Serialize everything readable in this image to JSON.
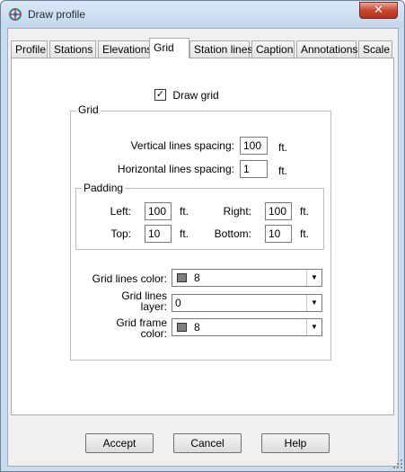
{
  "window": {
    "title": "Draw profile",
    "close_label": "✕"
  },
  "tabs": [
    {
      "label": "Profile"
    },
    {
      "label": "Stations"
    },
    {
      "label": "Elevations"
    },
    {
      "label": "Grid",
      "active": true
    },
    {
      "label": "Station lines"
    },
    {
      "label": "Caption"
    },
    {
      "label": "Annotations"
    },
    {
      "label": "Scale"
    }
  ],
  "grid_tab": {
    "draw_grid": {
      "label": "Draw grid",
      "checked": true,
      "mark": "✓"
    },
    "grid_group": {
      "label": "Grid",
      "vertical_spacing": {
        "label": "Vertical lines spacing:",
        "value": "100",
        "unit": "ft."
      },
      "horizontal_spacing": {
        "label": "Horizontal lines spacing:",
        "value": "1",
        "unit": "ft."
      },
      "padding": {
        "label": "Padding",
        "left": {
          "label": "Left:",
          "value": "100",
          "unit": "ft."
        },
        "right": {
          "label": "Right:",
          "value": "100",
          "unit": "ft."
        },
        "top": {
          "label": "Top:",
          "value": "10",
          "unit": "ft."
        },
        "bottom": {
          "label": "Bottom:",
          "value": "10",
          "unit": "ft."
        }
      },
      "grid_lines_color": {
        "label": "Grid lines color:",
        "value": "8",
        "swatch_color": "#808080"
      },
      "grid_lines_layer": {
        "label_line1": "Grid lines",
        "label_line2": "layer:",
        "value": "0"
      },
      "grid_frame_color": {
        "label_line1": "Grid frame",
        "label_line2": "color:",
        "value": "8",
        "swatch_color": "#808080"
      }
    }
  },
  "buttons": {
    "accept": "Accept",
    "cancel": "Cancel",
    "help": "Help"
  },
  "colors": {
    "window_frame": "#c9dbee",
    "close_button": "#c7462f",
    "dialog_bg": "#f0f0f0"
  }
}
